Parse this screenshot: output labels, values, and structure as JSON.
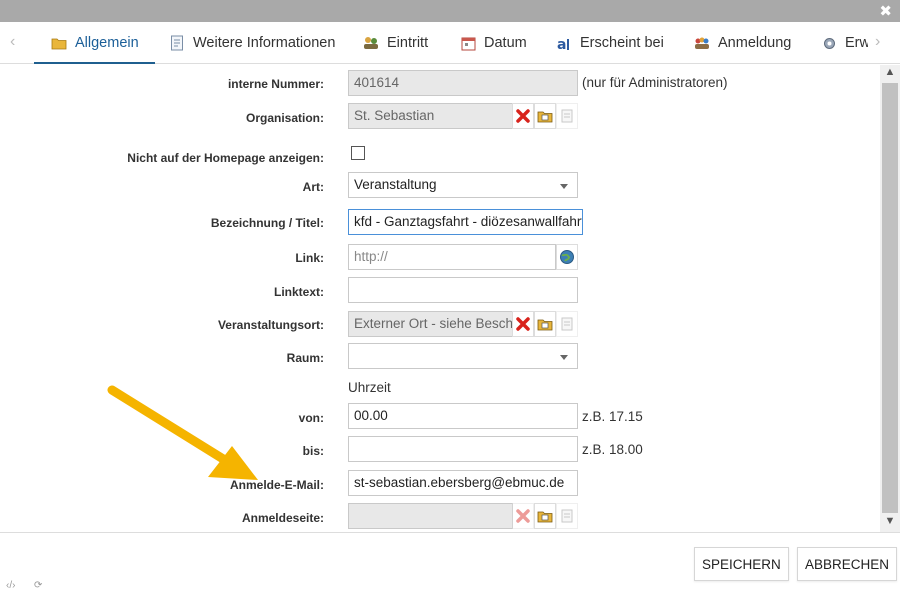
{
  "window": {
    "close_glyph": "✖"
  },
  "tabs": [
    {
      "label": "Allgemein",
      "icon": "folder-icon",
      "active": true
    },
    {
      "label": "Weitere Informationen",
      "icon": "document-icon"
    },
    {
      "label": "Eintritt",
      "icon": "people-icon"
    },
    {
      "label": "Datum",
      "icon": "calendar-icon"
    },
    {
      "label": "Erscheint bei",
      "icon": "publish-icon"
    },
    {
      "label": "Anmeldung",
      "icon": "group-icon"
    },
    {
      "label": "Erw",
      "icon": "gear-icon"
    }
  ],
  "form": {
    "interne_nummer": {
      "label": "interne Nummer:",
      "value": "401614",
      "note": "(nur für Administratoren)"
    },
    "organisation": {
      "label": "Organisation:",
      "value": "St. Sebastian"
    },
    "homepage": {
      "label": "Nicht auf der Homepage anzeigen:"
    },
    "art": {
      "label": "Art:",
      "value": "Veranstaltung"
    },
    "titel": {
      "label": "Bezeichnung / Titel:",
      "value": "kfd - Ganztagsfahrt - diözesanwallfahrt"
    },
    "link": {
      "label": "Link:",
      "placeholder": "http://"
    },
    "linktext": {
      "label": "Linktext:",
      "value": ""
    },
    "ort": {
      "label": "Veranstaltungsort:",
      "value": "Externer Ort - siehe Beschr"
    },
    "raum": {
      "label": "Raum:",
      "value": ""
    },
    "uhrzeit": {
      "heading": "Uhrzeit"
    },
    "von": {
      "label": "von:",
      "value": "00.00",
      "note": "z.B. 17.15"
    },
    "bis": {
      "label": "bis:",
      "value": "",
      "note": "z.B. 18.00"
    },
    "email": {
      "label": "Anmelde-E-Mail:",
      "value": "st-sebastian.ebersberg@ebmuc.de"
    },
    "anmeldeseite": {
      "label": "Anmeldeseite:",
      "value": ""
    }
  },
  "footer": {
    "save": "SPEICHERN",
    "cancel": "ABBRECHEN",
    "code_glyph": "‹/›",
    "refresh_glyph": "⟳"
  },
  "colors": {
    "accent": "#1f5f8f",
    "annotation_arrow": "#f5b400",
    "delete_red": "#d8231c"
  }
}
